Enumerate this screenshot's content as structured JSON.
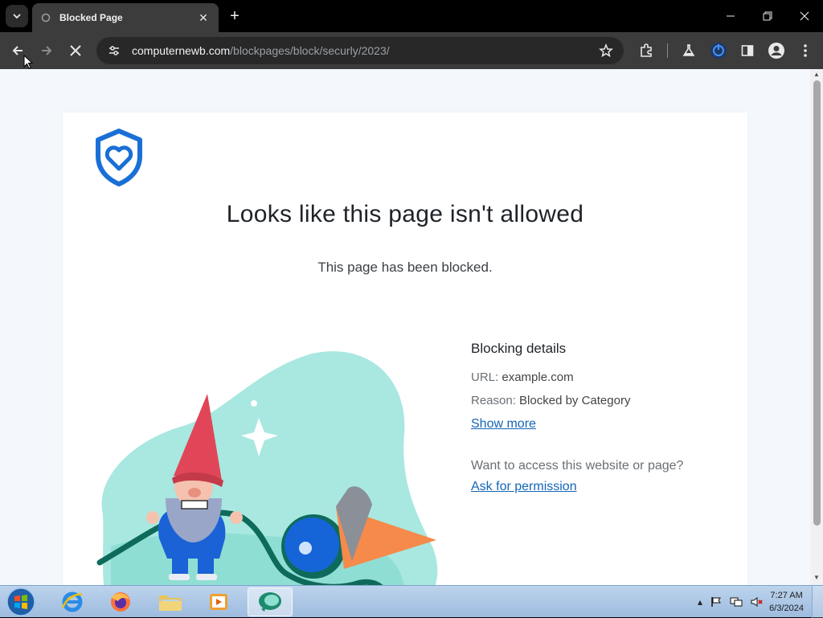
{
  "browser": {
    "tab": {
      "title": "Blocked Page"
    },
    "url": {
      "host": "computernewb.com",
      "path": "/blockpages/block/securly/2023/"
    }
  },
  "page": {
    "heading": "Looks like this page isn't allowed",
    "subheading": "This page has been blocked.",
    "details": {
      "title": "Blocking details",
      "url_label": "URL:",
      "url_value": "example.com",
      "reason_label": "Reason:",
      "reason_value": "Blocked by Category",
      "show_more": "Show more",
      "access_question": "Want to access this website or page?",
      "ask_permission": "Ask for permission"
    }
  },
  "taskbar": {
    "apps": [
      "internet-explorer",
      "firefox",
      "file-explorer",
      "media-player",
      "active-app"
    ],
    "clock_time": "7:27 AM",
    "clock_date": "6/3/2024"
  },
  "colors": {
    "accent_blue": "#1366b8",
    "shield_blue": "#1a6fd6",
    "blob_teal": "#a8e8e0"
  }
}
